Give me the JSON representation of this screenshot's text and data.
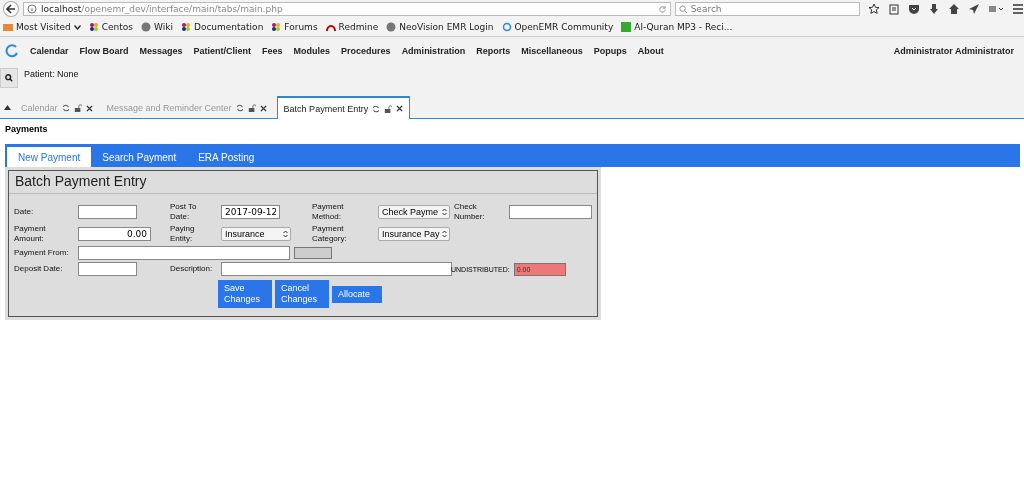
{
  "browser": {
    "url_host": "localhost",
    "url_path": "/openemr_dev/interface/main/tabs/main.php",
    "search": {
      "placeholder": "Search"
    },
    "bookmarks": [
      {
        "label": "Most Visited",
        "kind": "folder"
      },
      {
        "label": "Centos",
        "kind": "flower"
      },
      {
        "label": "Wiki",
        "kind": "globe"
      },
      {
        "label": "Documentation",
        "kind": "flower"
      },
      {
        "label": "Forums",
        "kind": "flower"
      },
      {
        "label": "Redmine",
        "kind": "arc"
      },
      {
        "label": "NeoVision EMR Login",
        "kind": "globe"
      },
      {
        "label": "OpenEMR Community",
        "kind": "ring"
      },
      {
        "label": "Al-Quran MP3 - Reci...",
        "kind": "quran"
      }
    ]
  },
  "menu": [
    "Calendar",
    "Flow Board",
    "Messages",
    "Patient/Client",
    "Fees",
    "Modules",
    "Procedures",
    "Administration",
    "Reports",
    "Miscellaneous",
    "Popups",
    "About"
  ],
  "user": "Administrator Administrator",
  "patient": "Patient: None",
  "tabs": [
    {
      "label": "Calendar",
      "selected": false
    },
    {
      "label": "Message and Reminder Center",
      "selected": false
    },
    {
      "label": "Batch Payment Entry",
      "selected": true
    }
  ],
  "page_title": "Payments",
  "subtabs": [
    {
      "label": "New Payment",
      "selected": true
    },
    {
      "label": "Search Payment",
      "selected": false
    },
    {
      "label": "ERA Posting",
      "selected": false
    }
  ],
  "form": {
    "title": "Batch Payment Entry",
    "date": {
      "label": "Date:"
    },
    "post_to_date": {
      "label": "Post To Date:",
      "value": "2017-09-12"
    },
    "payment_method": {
      "label": "Payment Method:",
      "value": "Check Payme"
    },
    "check_number": {
      "label": "Check Number:"
    },
    "payment_amount": {
      "label": "Payment Amount:",
      "value": "0.00"
    },
    "paying_entity": {
      "label": "Paying Entity:",
      "value": "Insurance"
    },
    "payment_category": {
      "label": "Payment Category:",
      "value": "Insurance Pay"
    },
    "payment_from": {
      "label": "Payment From:"
    },
    "deposit_date": {
      "label": "Deposit Date:"
    },
    "description": {
      "label": "Description:"
    },
    "undistributed": {
      "label": "UNDISTRIBUTED:",
      "value": "0.00"
    },
    "buttons": [
      "Save Changes",
      "Cancel Changes",
      "Allocate"
    ]
  }
}
